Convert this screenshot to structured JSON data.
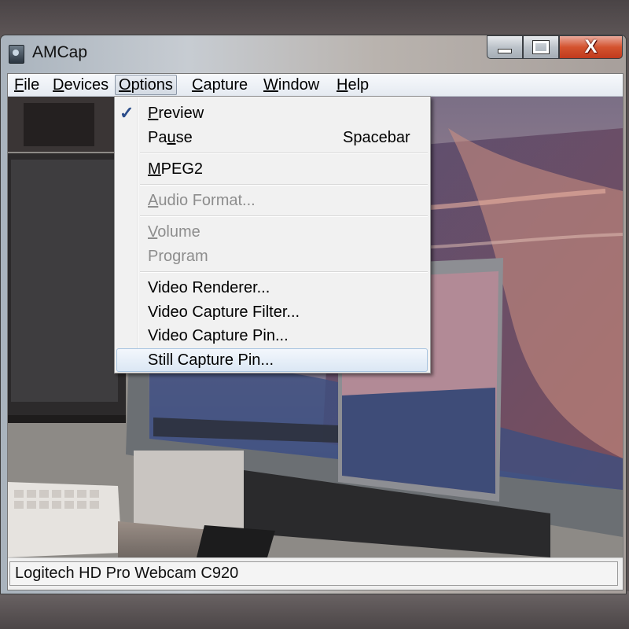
{
  "window": {
    "title": "AMCap",
    "close_glyph": "X"
  },
  "menubar": [
    {
      "name": "menu-file",
      "label": "File",
      "u": "F",
      "rest": "ile"
    },
    {
      "name": "menu-devices",
      "label": "Devices",
      "u": "D",
      "rest": "evices"
    },
    {
      "name": "menu-options",
      "label": "Options",
      "u": "O",
      "rest": "ptions"
    },
    {
      "name": "menu-capture",
      "label": "Capture",
      "u": "C",
      "rest": "apture"
    },
    {
      "name": "menu-window",
      "label": "Window",
      "u": "W",
      "rest": "indow"
    },
    {
      "name": "menu-help",
      "label": "Help",
      "u": "H",
      "rest": "elp"
    }
  ],
  "options_menu": {
    "check_glyph": "✓",
    "items": {
      "preview": {
        "pre": "",
        "u": "P",
        "post": "review",
        "checked": true,
        "enabled": true
      },
      "pause": {
        "pre": "Pa",
        "u": "u",
        "post": "se",
        "shortcut": "Spacebar",
        "enabled": true
      },
      "mpeg2": {
        "pre": "",
        "u": "M",
        "post": "PEG2",
        "enabled": true
      },
      "audio_format": {
        "pre": "",
        "u": "A",
        "post": "udio Format...",
        "enabled": false
      },
      "volume": {
        "pre": "",
        "u": "V",
        "post": "olume",
        "enabled": false
      },
      "program": {
        "pre": "Pro",
        "u": "g",
        "post": "ram",
        "enabled": false
      },
      "video_renderer": {
        "label": "Video Renderer...",
        "enabled": true
      },
      "video_capture_filter": {
        "label": "Video Capture Filter...",
        "enabled": true
      },
      "video_capture_pin": {
        "label": "Video Capture Pin...",
        "enabled": true
      },
      "still_capture_pin": {
        "label": "Still Capture Pin...",
        "enabled": true,
        "highlighted": true
      }
    }
  },
  "status": {
    "text": "Logitech HD Pro Webcam C920"
  },
  "colors": {
    "check": "#2a4c8a",
    "disabled_text": "#8d8d8d",
    "close_button": "#d4532f"
  },
  "icons": [
    "app-camera-icon",
    "minimize-icon",
    "maximize-icon",
    "close-icon",
    "checkmark-icon"
  ]
}
